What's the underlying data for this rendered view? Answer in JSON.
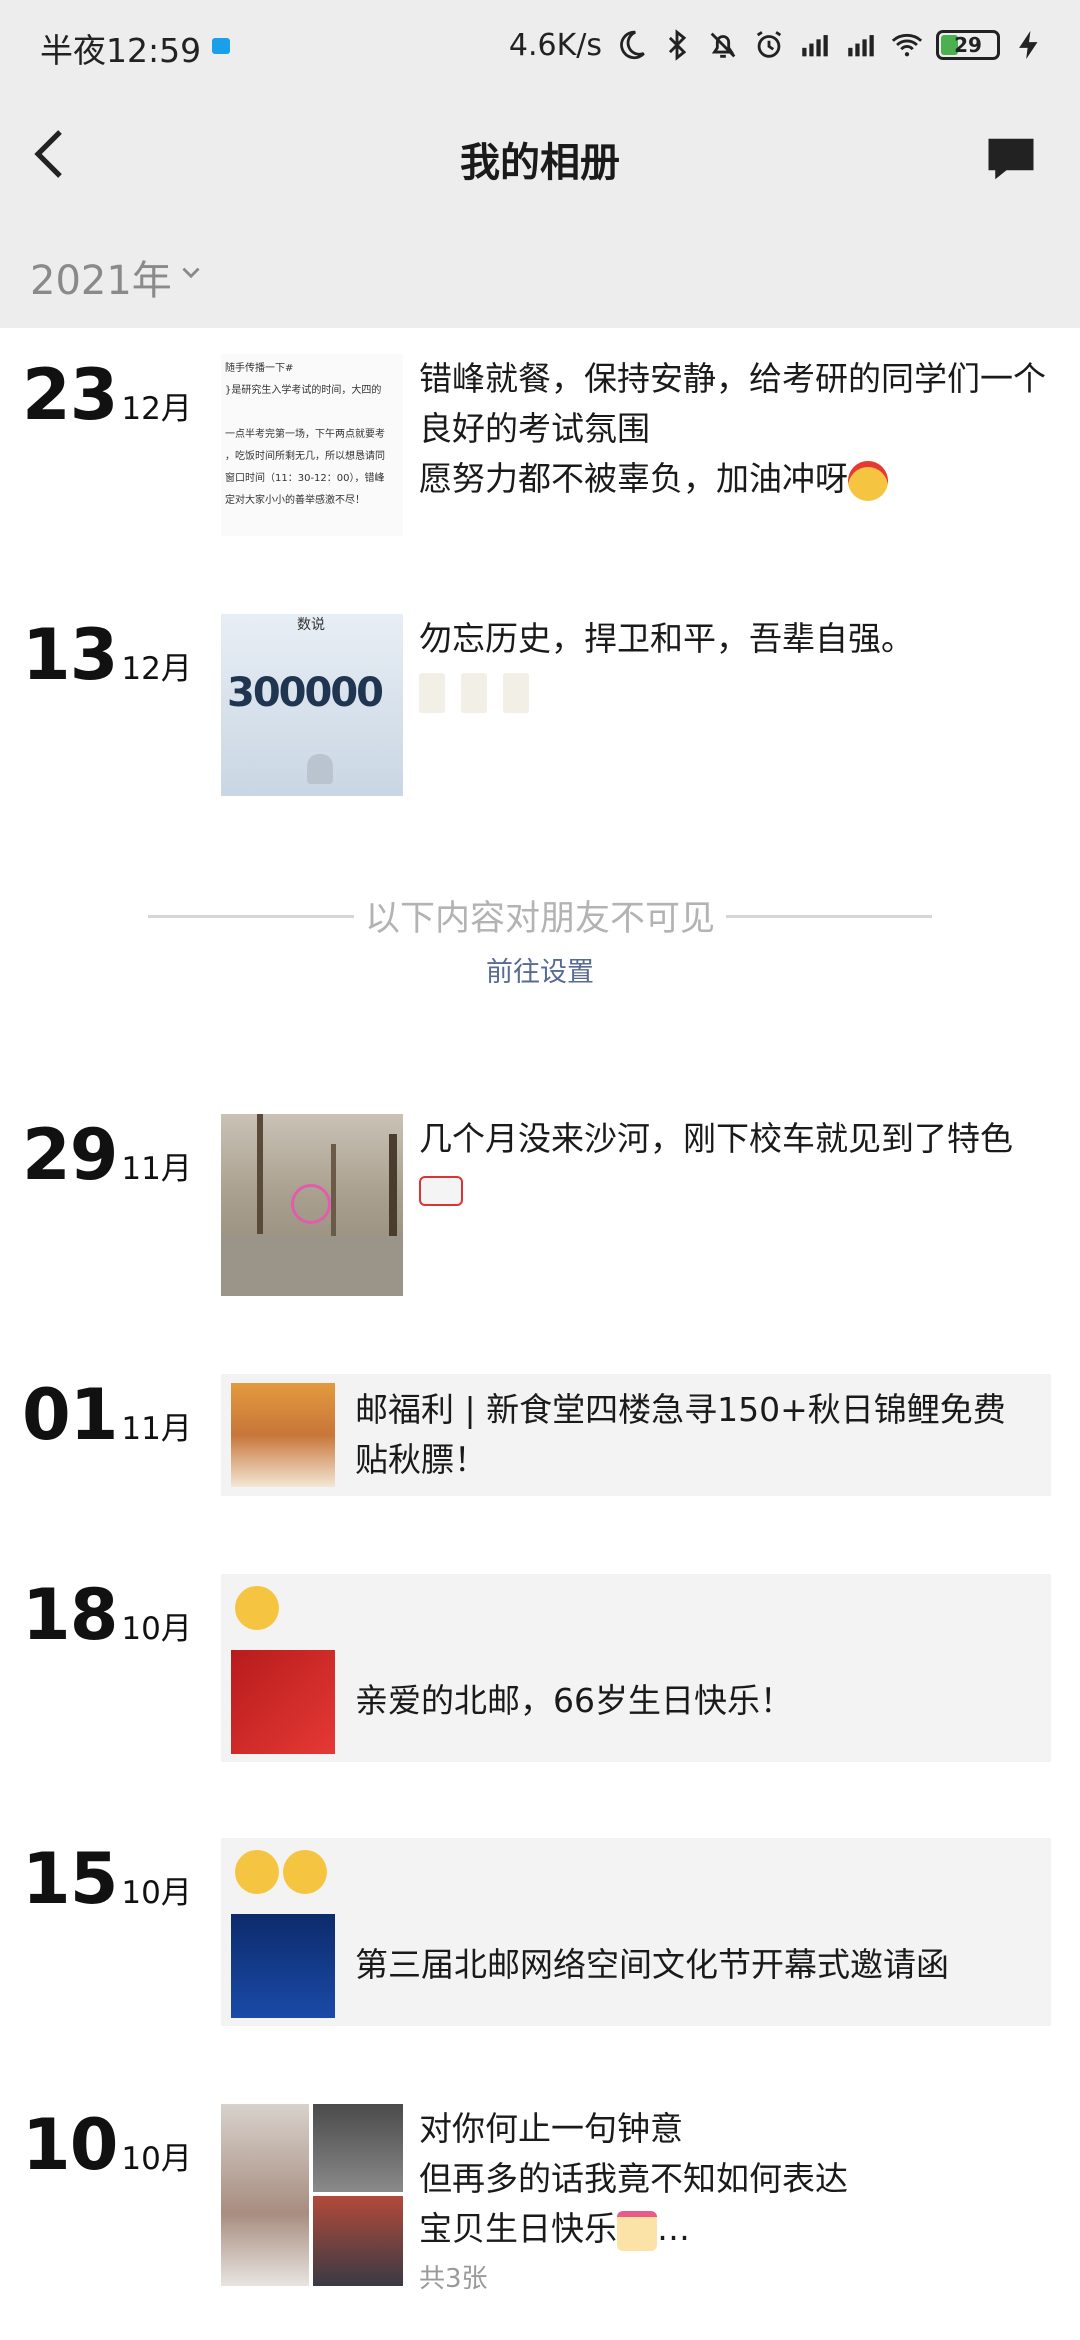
{
  "status_bar": {
    "time": "半夜12:59",
    "network_speed": "4.6K/s",
    "battery": "29",
    "icons": [
      "moon-icon",
      "bluetooth-icon",
      "mute-icon",
      "alarm-icon",
      "hd-signal-icon",
      "signal-icon",
      "wifi-icon",
      "battery-icon",
      "charging-icon"
    ]
  },
  "nav": {
    "title": "我的相册"
  },
  "year_filter": {
    "label": "2021年"
  },
  "colors": {
    "header_bg": "#ededed",
    "link": "#576b95"
  },
  "posts": [
    {
      "day": "23",
      "month": "12月",
      "text_lines": [
        "错峰就餐，保持安静，给考研的同学们一个",
        "良好的考试氛围",
        "愿努力都不被辜负，加油冲呀"
      ],
      "thumb_lines": [
        "随手传播一下#",
        "}是研究生入学考试的时间，大四的",
        "一点半考完第一场，下午两点就要考",
        "，吃饭时间所剩无几，所以想恳请同",
        "窗口时间（11：30-12：00），错峰",
        "定对大家小小的善举感激不尽！"
      ]
    },
    {
      "day": "13",
      "month": "12月",
      "text_lines": [
        "勿忘历史，捍卫和平，吾辈自强。"
      ],
      "thumb_text": "300000",
      "thumb_caption": "数说"
    },
    {
      "day": "29",
      "month": "11月",
      "text_lines": [
        "几个月没来沙河，刚下校车就见到了特色"
      ]
    },
    {
      "day": "01",
      "month": "11月",
      "share_title": "邮福利 | 新食堂四楼急寻150+秋日锦鲤免费贴秋膘！",
      "share_lines": [
        "邮福利 | 新食堂四楼急寻150+秋日锦鲤免费",
        "贴秋膘！"
      ]
    },
    {
      "day": "18",
      "month": "10月",
      "share_title": "亲爱的北邮，66岁生日快乐！"
    },
    {
      "day": "15",
      "month": "10月",
      "share_title": "第三届北邮网络空间文化节开幕式邀请函"
    },
    {
      "day": "10",
      "month": "10月",
      "text_lines": [
        "对你何止一句钟意",
        "但再多的话我竟不知如何表达",
        "宝贝生日快乐"
      ],
      "ellipsis": "…",
      "count": "共3张"
    }
  ],
  "privacy_divider": {
    "text": "以下内容对朋友不可见",
    "link": "前往设置"
  }
}
